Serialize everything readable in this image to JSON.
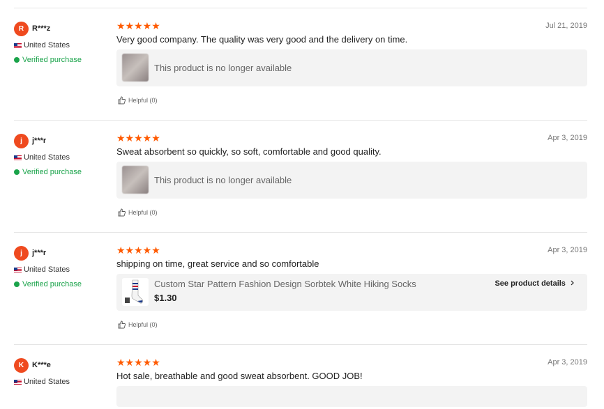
{
  "reviews": [
    {
      "avatar_letter": "R",
      "username": "R***z",
      "country": "United States",
      "verified": "Verified purchase",
      "stars": "★★★★★",
      "date": "Jul 21, 2019",
      "text": "Very good company. The quality was very good and the delivery on time.",
      "product_text": "This product is no longer available",
      "helpful": "Helpful (0)"
    },
    {
      "avatar_letter": "j",
      "username": "j***r",
      "country": "United States",
      "verified": "Verified purchase",
      "stars": "★★★★★",
      "date": "Apr 3, 2019",
      "text": "Sweat absorbent so quickly, so soft, comfortable and good quality.",
      "product_text": "This product is no longer available",
      "helpful": "Helpful (0)"
    },
    {
      "avatar_letter": "j",
      "username": "j***r",
      "country": "United States",
      "verified": "Verified purchase",
      "stars": "★★★★★",
      "date": "Apr 3, 2019",
      "text": "shipping on time, great service and so comfortable",
      "product_title": "Custom Star Pattern Fashion Design Sorbtek White Hiking Socks",
      "product_price": "$1.30",
      "product_link": "See product details",
      "helpful": "Helpful (0)"
    },
    {
      "avatar_letter": "K",
      "username": "K***e",
      "country": "United States",
      "stars": "★★★★★",
      "date": "Apr 3, 2019",
      "text": "Hot sale, breathable and good sweat absorbent. GOOD JOB!"
    }
  ],
  "colors": {
    "accent": "#ff5a00",
    "verified": "#1aa34a",
    "avatar": "#ef4a1f"
  },
  "icons": {
    "thumb": "thumbs-up-icon",
    "chevron": "chevron-right-icon"
  }
}
